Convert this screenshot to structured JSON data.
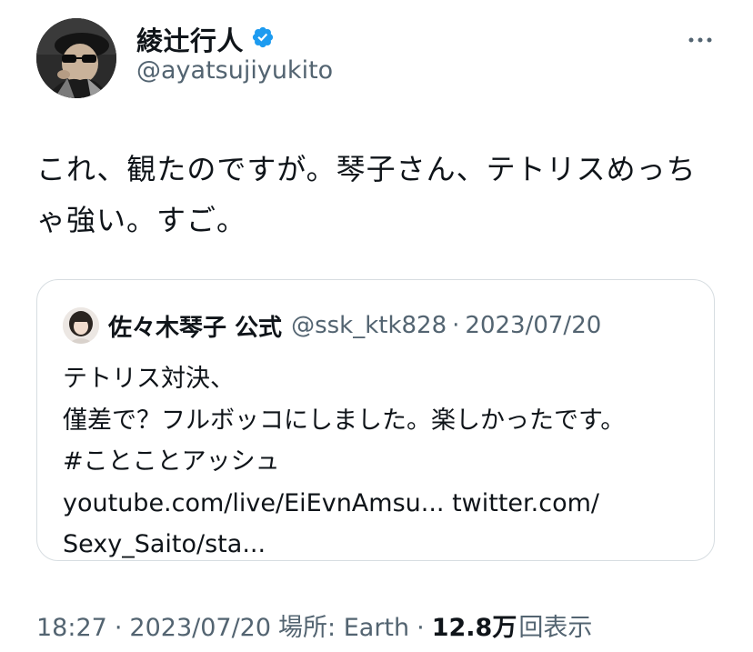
{
  "author": {
    "name": "綾辻行人",
    "handle": "@ayatsujiyukito",
    "verified": true
  },
  "tweet": {
    "text_line1": "これ、観たのですが。琴子さん、テトリスめっち",
    "text_line2": "ゃ強い。すご。"
  },
  "quote": {
    "name": "佐々木琴子 公式",
    "handle": "@ssk_ktk828",
    "separator": "·",
    "date": "2023/07/20",
    "lines": [
      "テトリス対決、",
      "僅差で？フルボッコにしました。楽しかったです。",
      "#ことことアッシュ",
      "youtube.com/live/EiEvnAmsu... twitter.com/",
      "Sexy_Saito/sta..."
    ]
  },
  "meta": {
    "time": "18:27",
    "dot": "·",
    "date": "2023/07/20",
    "location": "場所: Earth",
    "views_count": "12.8万",
    "views_label": "回表示"
  },
  "colors": {
    "verified": "#1d9bf0",
    "secondary_text": "#536471",
    "border": "#d7dde1"
  },
  "icons": {
    "more": "more-horizontal-icon",
    "verified": "verified-badge-icon"
  }
}
